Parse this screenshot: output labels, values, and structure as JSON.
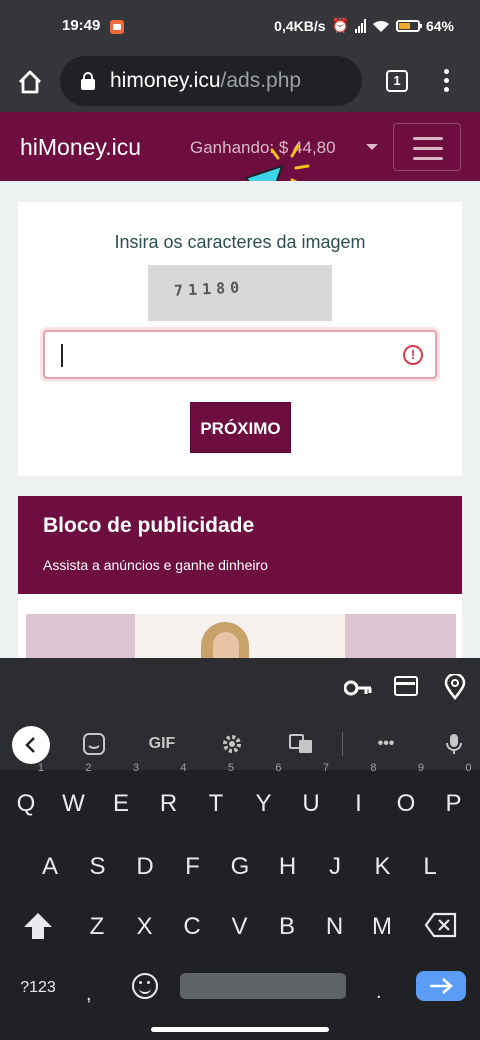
{
  "status_bar": {
    "time": "19:49",
    "network_speed": "0,4KB/s",
    "battery": "64%",
    "battery_level": 0.64,
    "icons": [
      "screen-record-icon",
      "alarm-icon",
      "signal-icon",
      "wifi-icon",
      "battery-icon"
    ]
  },
  "browser": {
    "url_host": "himoney.icu",
    "url_path": "/ads.php",
    "tab_count": "1"
  },
  "site": {
    "brand": "hiMoney.icu",
    "earned_label": "Ganhando: $ 44,80"
  },
  "captcha": {
    "title": "Insira os caracteres da imagem",
    "code": "71180",
    "input_value": "",
    "next_label": "PRÓXIMO"
  },
  "ads": {
    "title": "Bloco de publicidade",
    "subtitle": "Assista a anúncios e ganhe dinheiro"
  },
  "keyboard": {
    "toolbar": {
      "gif_label": "GIF"
    },
    "row1": [
      {
        "key": "Q",
        "hint": "1"
      },
      {
        "key": "W",
        "hint": "2"
      },
      {
        "key": "E",
        "hint": "3"
      },
      {
        "key": "R",
        "hint": "4"
      },
      {
        "key": "T",
        "hint": "5"
      },
      {
        "key": "Y",
        "hint": "6"
      },
      {
        "key": "U",
        "hint": "7"
      },
      {
        "key": "I",
        "hint": "8"
      },
      {
        "key": "O",
        "hint": "9"
      },
      {
        "key": "P",
        "hint": "0"
      }
    ],
    "row2": [
      "A",
      "S",
      "D",
      "F",
      "G",
      "H",
      "J",
      "K",
      "L"
    ],
    "row3": [
      "Z",
      "X",
      "C",
      "V",
      "B",
      "N",
      "M"
    ],
    "symbols_label": "?123",
    "comma": ",",
    "period": "."
  },
  "colors": {
    "brand": "#6e0d3f",
    "accent_blue": "#5b9cf7",
    "error": "#d93a4b",
    "battery": "#f0a92f"
  }
}
